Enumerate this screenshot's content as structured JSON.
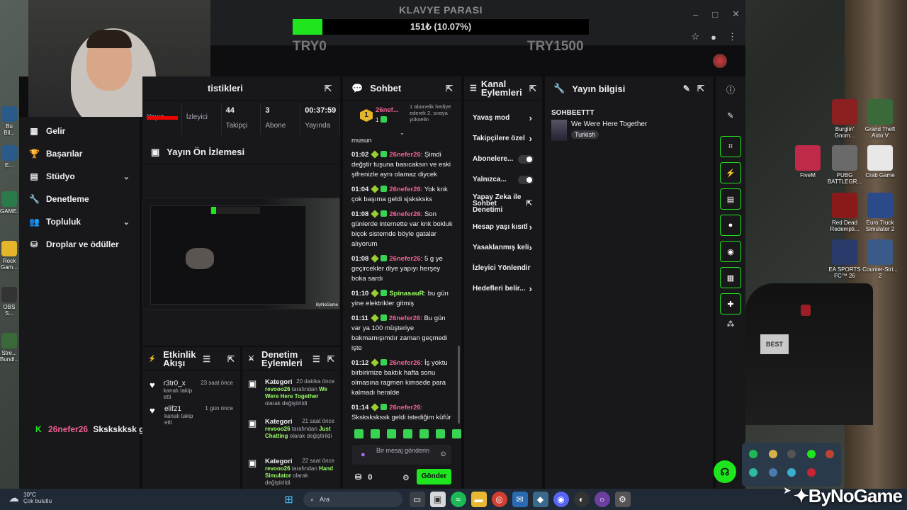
{
  "overlay": {
    "title": "KLAVYE PARASI",
    "progress_text": "151₺ (10.07%)",
    "progress_fraction": 0.1007,
    "min_label": "TRY0",
    "max_label": "TRY1500"
  },
  "stats": {
    "title": "tistikleri",
    "items": [
      {
        "value": "",
        "label": "Yayın"
      },
      {
        "value": "",
        "label": "İzleyici"
      },
      {
        "value": "44",
        "label": "Takipçi"
      },
      {
        "value": "3",
        "label": "Abone"
      },
      {
        "value": "00:37:59",
        "label": "Yayında"
      }
    ]
  },
  "sidebar": {
    "items": [
      {
        "label": "Gelir",
        "icon": "grid-icon"
      },
      {
        "label": "Başarılar",
        "icon": "trophy-icon"
      },
      {
        "label": "Stüdyo",
        "icon": "studio-icon",
        "expandable": true
      },
      {
        "label": "Denetleme",
        "icon": "wrench-icon"
      },
      {
        "label": "Topluluk",
        "icon": "community-icon",
        "expandable": true
      },
      {
        "label": "Droplar ve ödüller",
        "icon": "drops-icon"
      }
    ]
  },
  "preview": {
    "title": "Yayın Ön İzlemesi"
  },
  "chat": {
    "title": "Sohbet",
    "pinned": {
      "rank": "1",
      "user": "26nef...",
      "count": "1",
      "text": "1 abonelik hediye ederek 2. sıraya yükselin"
    },
    "partial_top": "musun",
    "messages": [
      {
        "time": "01:02",
        "user": "26nefer26",
        "text": "Şimdi değştir tuşuna basıcaksın ve eski şifrenizle aynı olamaz diycek"
      },
      {
        "time": "01:04",
        "user": "26nefer26",
        "text": "Yok knk çok başıma geldi sjsksksks"
      },
      {
        "time": "01:08",
        "user": "26nefer26",
        "text": "Son günlerde internette var knk bokluk biçok sistemde böyle gatalar alıyorum"
      },
      {
        "time": "01:08",
        "user": "26nefer26",
        "text": "5 g ye geçircekler diye yapıyı herşey boka sardı"
      },
      {
        "time": "01:10",
        "user": "SpinasauR",
        "text": "bu gün yine elektrikler gitmiş",
        "alt": true
      },
      {
        "time": "01:11",
        "user": "26nefer26",
        "text": "Bu gün var ya 100 müşteriye bakmamışımdır zaman geçmedi işte"
      },
      {
        "time": "01:12",
        "user": "26nefer26",
        "text": "İş yoktu birbirimize baktık hafta sonu olmasına ragmen kimsede para kalmadı heralde"
      },
      {
        "time": "01:14",
        "user": "26nefer26",
        "text": "Skskskskssk geldi istediğim küfür"
      }
    ],
    "input_placeholder": "Bir mesaj gönderin",
    "points": "0",
    "send_label": "Gönder"
  },
  "actions": {
    "title": "Kanal Eylemleri",
    "items": [
      {
        "label": "Yavaş mod",
        "kind": "arrow"
      },
      {
        "label": "Takipçilere özel",
        "kind": "arrow"
      },
      {
        "label": "Abonelere...",
        "kind": "toggle"
      },
      {
        "label": "Yalnızca...",
        "kind": "toggle"
      },
      {
        "label": "Yapay Zeka ile Sohbet Denetimi",
        "kind": "external"
      },
      {
        "label": "Hesap yaşı kısıtl",
        "kind": "arrow"
      },
      {
        "label": "Yasaklanmış keli",
        "kind": "arrow"
      },
      {
        "label": "İzleyici Yönlendir",
        "kind": "none"
      },
      {
        "label": "Hedefleri belir...",
        "kind": "arrow"
      }
    ]
  },
  "stream_info": {
    "title": "Yayın bilgisi",
    "stream_title": "SOHBEETTT",
    "category": "We Were Here Together",
    "tag": "Turkish"
  },
  "events": {
    "title": "Etkinlik Akışı",
    "items": [
      {
        "name": "r3tr0_x",
        "sub": "kanalı takip etti",
        "time": "23 saat önce"
      },
      {
        "name": "elif21",
        "sub": "kanalı takip etti",
        "time": "1 gün önce"
      }
    ]
  },
  "mod_actions": {
    "title": "Denetim Eylemleri",
    "items": [
      {
        "title": "Kategori",
        "time": "20 dakika önce",
        "user": "revooo26",
        "mid": " tarafından ",
        "target": "We Were Here Together",
        "end": " olarak değiştirildi"
      },
      {
        "title": "Kategori",
        "time": "21 saat önce",
        "user": "revooo26",
        "mid": " tarafından ",
        "target": "Just Chatting",
        "end": " olarak değiştirildi"
      },
      {
        "title": "Kategori",
        "time": "22 saat önce",
        "user": "revooo26",
        "mid": " tarafından ",
        "target": "Hand Simulator",
        "end": " olarak değiştirildi"
      }
    ]
  },
  "alert": {
    "user": "26nefer26",
    "text": "Skskskksk geldi istediğim küfür"
  },
  "desktop_icons": [
    {
      "label": "Burglin' Gnom...",
      "color": "#8a2020"
    },
    {
      "label": "Grand Theft Auto V",
      "color": "#3a6a3a"
    },
    {
      "label": "FiveM",
      "color": "#c02a4a"
    },
    {
      "label": "PUBG BATTLEGR...",
      "color": "#6a6a6a"
    },
    {
      "label": "Crab Game",
      "color": "#e8e8e8"
    },
    {
      "label": "Red Dead Redempti...",
      "color": "#8a1a1a"
    },
    {
      "label": "Euro Truck Simulator 2",
      "color": "#2a4a8a"
    },
    {
      "label": "EA SPORTS FC™ 26",
      "color": "#2a3a6a"
    },
    {
      "label": "Counter-Stri... 2",
      "color": "#3a5a8a"
    }
  ],
  "left_icons": [
    "Bu Bil...",
    "E...",
    "GAME...",
    "Rock Gam...",
    "OBS S...",
    "Stre... Bundl..."
  ],
  "taskbar": {
    "weather_temp": "10°C",
    "weather_desc": "Çok bulutlu",
    "search": "Ara"
  },
  "watermark": "ByNoGame",
  "colors": {
    "accent": "#1ee51e",
    "username": "#f06292",
    "panel": "#18181b",
    "background": "#0e0e10"
  }
}
